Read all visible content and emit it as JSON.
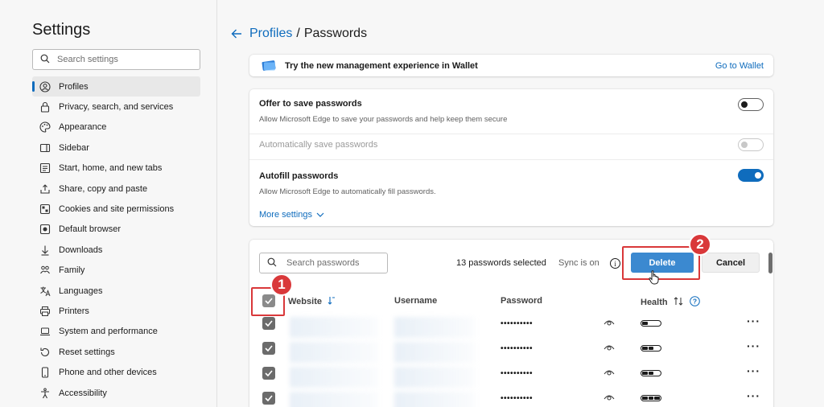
{
  "sidebar": {
    "title": "Settings",
    "search_placeholder": "Search settings",
    "items": [
      {
        "label": "Profiles",
        "icon": "profile-icon",
        "active": true
      },
      {
        "label": "Privacy, search, and services",
        "icon": "lock-icon"
      },
      {
        "label": "Appearance",
        "icon": "palette-icon"
      },
      {
        "label": "Sidebar",
        "icon": "sidebar-icon"
      },
      {
        "label": "Start, home, and new tabs",
        "icon": "home-icon"
      },
      {
        "label": "Share, copy and paste",
        "icon": "share-icon"
      },
      {
        "label": "Cookies and site permissions",
        "icon": "cookie-icon"
      },
      {
        "label": "Default browser",
        "icon": "browser-icon"
      },
      {
        "label": "Downloads",
        "icon": "download-icon"
      },
      {
        "label": "Family",
        "icon": "family-icon"
      },
      {
        "label": "Languages",
        "icon": "language-icon"
      },
      {
        "label": "Printers",
        "icon": "printer-icon"
      },
      {
        "label": "System and performance",
        "icon": "laptop-icon"
      },
      {
        "label": "Reset settings",
        "icon": "reset-icon"
      },
      {
        "label": "Phone and other devices",
        "icon": "phone-icon"
      },
      {
        "label": "Accessibility",
        "icon": "accessibility-icon"
      }
    ]
  },
  "breadcrumb": {
    "parent": "Profiles",
    "separator": "/",
    "current": "Passwords"
  },
  "wallet": {
    "text": "Try the new management experience in Wallet",
    "link": "Go to Wallet"
  },
  "settings": {
    "offer": {
      "title": "Offer to save passwords",
      "desc": "Allow Microsoft Edge to save your passwords and help keep them secure",
      "state": "off"
    },
    "auto_save": {
      "title": "Automatically save passwords",
      "state": "disabled"
    },
    "autofill": {
      "title": "Autofill passwords",
      "desc": "Allow Microsoft Edge to automatically fill passwords.",
      "state": "on"
    },
    "more_settings": "More settings"
  },
  "passwords": {
    "search_placeholder": "Search passwords",
    "selected_text": "13 passwords selected",
    "sync_text": "Sync is on",
    "info_glyph": "i",
    "delete_label": "Delete",
    "cancel_label": "Cancel",
    "columns": {
      "website": "Website",
      "username": "Username",
      "password": "Password",
      "health": "Health"
    },
    "rows": [
      {
        "password": "••••••••••",
        "health_level": 1
      },
      {
        "password": "••••••••••",
        "health_level": 2
      },
      {
        "password": "••••••••••",
        "health_level": 2
      },
      {
        "password": "••••••••••",
        "health_level": 3
      }
    ],
    "more_glyph": "···"
  },
  "annotations": {
    "badge1": "1",
    "badge2": "2",
    "color": "#d9383a"
  },
  "colors": {
    "accent": "#0f6cbd",
    "delete_button": "#3b89d0"
  }
}
